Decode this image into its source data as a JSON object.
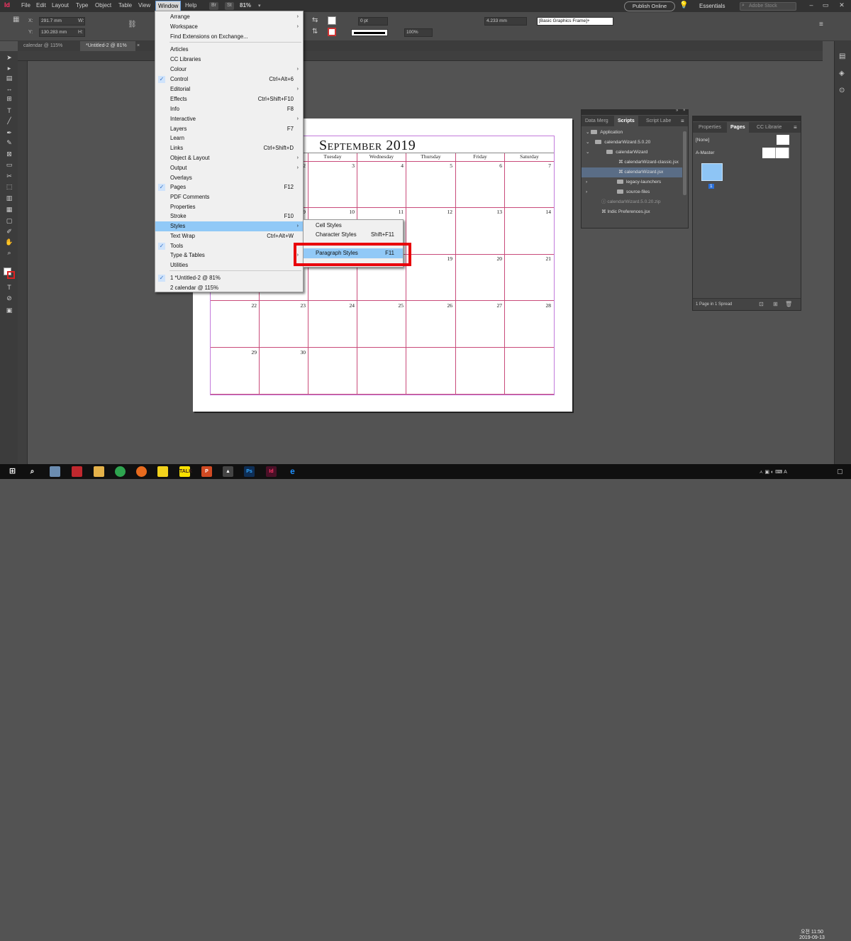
{
  "menubar": {
    "app_logo": "Id",
    "menus": [
      "File",
      "Edit",
      "Layout",
      "Type",
      "Object",
      "Table",
      "View",
      "Window",
      "Help"
    ],
    "bridge": "Br",
    "stock": "St",
    "zoom": "81%",
    "publish_label": "Publish Online",
    "workspace": "Essentials",
    "search_placeholder": "Adobe Stock"
  },
  "control": {
    "x_label": "X:",
    "x_value": "291.7 mm",
    "y_label": "Y:",
    "y_value": "130.283 mm",
    "w_label": "W:",
    "h_label": "H:",
    "stroke_weight": "0 pt",
    "opacity": "100%",
    "ref_value": "4.233 mm",
    "object_style": "[Basic Graphics Frame]+"
  },
  "doc_tabs": [
    "calendar @ 115%",
    "*Untitled-2 @ 81%"
  ],
  "calendar": {
    "title": "September 2019",
    "days": [
      "Tuesday",
      "Wednesday",
      "Thursday",
      "Friday",
      "Saturday"
    ],
    "row1": [
      "2",
      "3",
      "4",
      "5",
      "6",
      "7"
    ],
    "row2": [
      "9",
      "10",
      "11",
      "12",
      "13",
      "14"
    ],
    "row3": [
      "19",
      "20",
      "21"
    ],
    "row4": [
      "22",
      "23",
      "24",
      "25",
      "26",
      "27",
      "28"
    ],
    "row5": [
      "29",
      "30"
    ]
  },
  "window_menu": {
    "items": [
      {
        "label": "Arrange",
        "shortcut": "",
        "submenu": true,
        "checked": false
      },
      {
        "label": "Workspace",
        "shortcut": "",
        "submenu": true,
        "checked": false
      },
      {
        "label": "Find Extensions on Exchange...",
        "shortcut": "",
        "submenu": false,
        "checked": false
      },
      {
        "label": "Articles",
        "shortcut": "",
        "submenu": false,
        "checked": false
      },
      {
        "label": "CC Libraries",
        "shortcut": "",
        "submenu": false,
        "checked": false
      },
      {
        "label": "Colour",
        "shortcut": "",
        "submenu": true,
        "checked": false
      },
      {
        "label": "Control",
        "shortcut": "Ctrl+Alt+6",
        "submenu": false,
        "checked": true
      },
      {
        "label": "Editorial",
        "shortcut": "",
        "submenu": true,
        "checked": false
      },
      {
        "label": "Effects",
        "shortcut": "Ctrl+Shift+F10",
        "submenu": false,
        "checked": false
      },
      {
        "label": "Info",
        "shortcut": "F8",
        "submenu": false,
        "checked": false
      },
      {
        "label": "Interactive",
        "shortcut": "",
        "submenu": true,
        "checked": false
      },
      {
        "label": "Layers",
        "shortcut": "F7",
        "submenu": false,
        "checked": false
      },
      {
        "label": "Learn",
        "shortcut": "",
        "submenu": false,
        "checked": false
      },
      {
        "label": "Links",
        "shortcut": "Ctrl+Shift+D",
        "submenu": false,
        "checked": false
      },
      {
        "label": "Object & Layout",
        "shortcut": "",
        "submenu": true,
        "checked": false
      },
      {
        "label": "Output",
        "shortcut": "",
        "submenu": true,
        "checked": false
      },
      {
        "label": "Overlays",
        "shortcut": "",
        "submenu": false,
        "checked": false
      },
      {
        "label": "Pages",
        "shortcut": "F12",
        "submenu": false,
        "checked": true
      },
      {
        "label": "PDF Comments",
        "shortcut": "",
        "submenu": false,
        "checked": false
      },
      {
        "label": "Properties",
        "shortcut": "",
        "submenu": false,
        "checked": false
      },
      {
        "label": "Stroke",
        "shortcut": "F10",
        "submenu": false,
        "checked": false
      },
      {
        "label": "Styles",
        "shortcut": "",
        "submenu": true,
        "checked": false,
        "highlighted": true
      },
      {
        "label": "Text Wrap",
        "shortcut": "Ctrl+Alt+W",
        "submenu": false,
        "checked": false
      },
      {
        "label": "Tools",
        "shortcut": "",
        "submenu": false,
        "checked": true
      },
      {
        "label": "Type & Tables",
        "shortcut": "",
        "submenu": true,
        "checked": false
      },
      {
        "label": "Utilities",
        "shortcut": "",
        "submenu": true,
        "checked": false
      },
      {
        "label": "1 *Untitled-2 @ 81%",
        "shortcut": "",
        "submenu": false,
        "checked": true
      },
      {
        "label": "2 calendar @ 115%",
        "shortcut": "",
        "submenu": false,
        "checked": false
      }
    ]
  },
  "styles_submenu": {
    "items": [
      {
        "label": "Cell Styles",
        "shortcut": ""
      },
      {
        "label": "Character Styles",
        "shortcut": "Shift+F11"
      },
      {
        "label": "Paragraph Styles",
        "shortcut": "F11"
      }
    ]
  },
  "scripts_panel": {
    "tabs": [
      "Data Merg",
      "Scripts",
      "Script Labe"
    ],
    "rows": [
      "Application",
      "calendarWizard.5.0.20",
      "calendarWizard",
      "calendarWizard-classic.jsx",
      "calendarWizard.jsx",
      "legacy-launchers",
      "source-files",
      "calendarWizard.5.0.20.zip",
      "Indic Preferences.jsx"
    ]
  },
  "pages_panel": {
    "tabs": [
      "Properties",
      "Pages",
      "CC Librarie"
    ],
    "none_label": "[None]",
    "master_label": "A-Master",
    "page_num": "1",
    "footer": "1 Page in 1 Spread"
  },
  "taskbar": {
    "time": "오전 11:50",
    "date": "2019-09-13"
  }
}
